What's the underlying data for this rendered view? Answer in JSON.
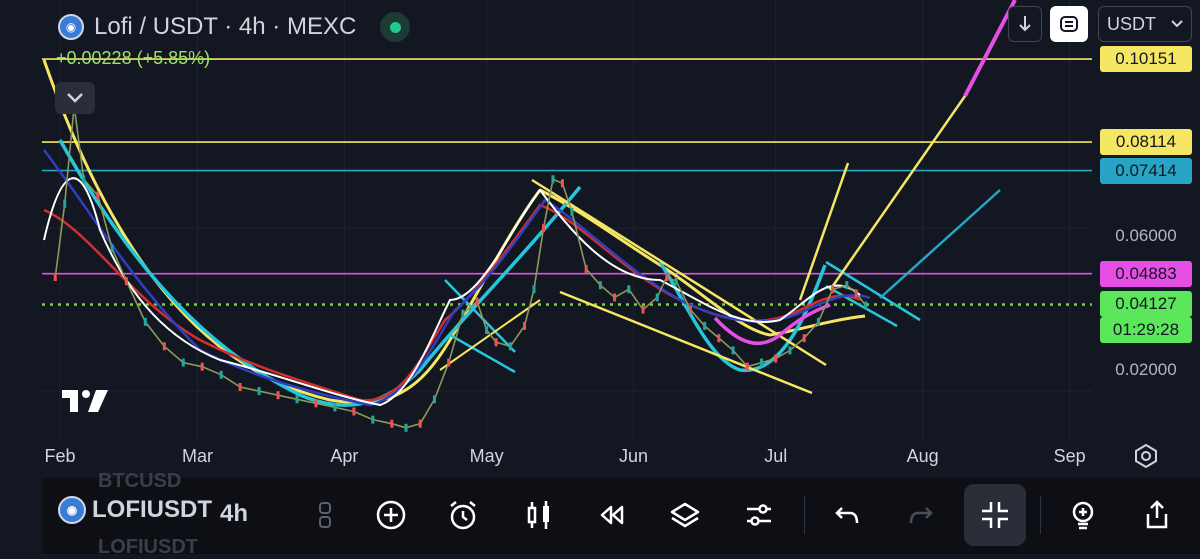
{
  "header": {
    "title": "Lofi / USDT · 4h · MEXC",
    "change": "+0.00228 (+5.85%)"
  },
  "toolbar_top": {
    "currency": "USDT"
  },
  "price_labels": [
    {
      "value": "0.10151",
      "price": 0.10151,
      "bg": "#f5e663"
    },
    {
      "value": "0.08114",
      "price": 0.08114,
      "bg": "#f5e663"
    },
    {
      "value": "0.07414",
      "price": 0.07414,
      "bg": "#26a5c4"
    },
    {
      "value": "0.04883",
      "price": 0.04883,
      "bg": "#e64fe6"
    },
    {
      "value": "0.04127",
      "price": 0.04127,
      "bg": "#5be65b",
      "countdown": "01:29:28"
    }
  ],
  "bottom_bar": {
    "ticker": "LOFIUSDT",
    "ghost_above": "BTCUSD",
    "ghost_below": "LOFIUSDT",
    "interval": "4h"
  },
  "chart_data": {
    "type": "line",
    "pair": "Lofi / USDT",
    "timeframe": "4h",
    "exchange": "MEXC",
    "ylim": [
      0.008,
      0.116
    ],
    "y_ticks": [
      {
        "label": "0.06000",
        "value": 0.06
      },
      {
        "label": "0.02000",
        "value": 0.02
      }
    ],
    "x_ticks": [
      {
        "label": "Feb",
        "day": 0
      },
      {
        "label": "Mar",
        "day": 29
      },
      {
        "label": "Apr",
        "day": 60
      },
      {
        "label": "May",
        "day": 90
      },
      {
        "label": "Jun",
        "day": 121
      },
      {
        "label": "Jul",
        "day": 151
      },
      {
        "label": "Aug",
        "day": 182
      },
      {
        "label": "Sep",
        "day": 213
      }
    ],
    "price_series": {
      "name": "Lofi/USDT",
      "days": [
        -1,
        1,
        3,
        5,
        8,
        11,
        14,
        18,
        22,
        26,
        30,
        34,
        38,
        42,
        46,
        50,
        54,
        58,
        62,
        66,
        70,
        73,
        76,
        79,
        82,
        85,
        88,
        90,
        92,
        95,
        98,
        100,
        102,
        104,
        106,
        108,
        111,
        114,
        117,
        120,
        123,
        126,
        128,
        130,
        133,
        136,
        139,
        142,
        145,
        148,
        151,
        154,
        157,
        160,
        163,
        166,
        168,
        170
      ],
      "values": [
        0.048,
        0.066,
        0.09,
        0.072,
        0.068,
        0.055,
        0.047,
        0.037,
        0.031,
        0.027,
        0.026,
        0.024,
        0.021,
        0.02,
        0.019,
        0.018,
        0.017,
        0.016,
        0.015,
        0.013,
        0.012,
        0.011,
        0.012,
        0.018,
        0.027,
        0.039,
        0.042,
        0.035,
        0.032,
        0.031,
        0.036,
        0.045,
        0.06,
        0.072,
        0.071,
        0.064,
        0.05,
        0.046,
        0.043,
        0.045,
        0.04,
        0.043,
        0.048,
        0.047,
        0.04,
        0.036,
        0.033,
        0.03,
        0.026,
        0.027,
        0.028,
        0.03,
        0.033,
        0.037,
        0.045,
        0.046,
        0.044,
        0.041
      ]
    },
    "hlines": [
      {
        "value": 0.10151,
        "color": "#f5e663"
      },
      {
        "value": 0.08114,
        "color": "#f5e663"
      },
      {
        "value": 0.07414,
        "color": "#26a5c4"
      },
      {
        "value": 0.04883,
        "color": "#e64fe6"
      },
      {
        "value": 0.04127,
        "color": "#7bd23a",
        "dotted": true
      }
    ]
  },
  "colors": {
    "background": "#131722",
    "yellow": "#f5e663",
    "cyan": "#26a5c4",
    "magenta": "#e64fe6",
    "green": "#5be65b"
  }
}
